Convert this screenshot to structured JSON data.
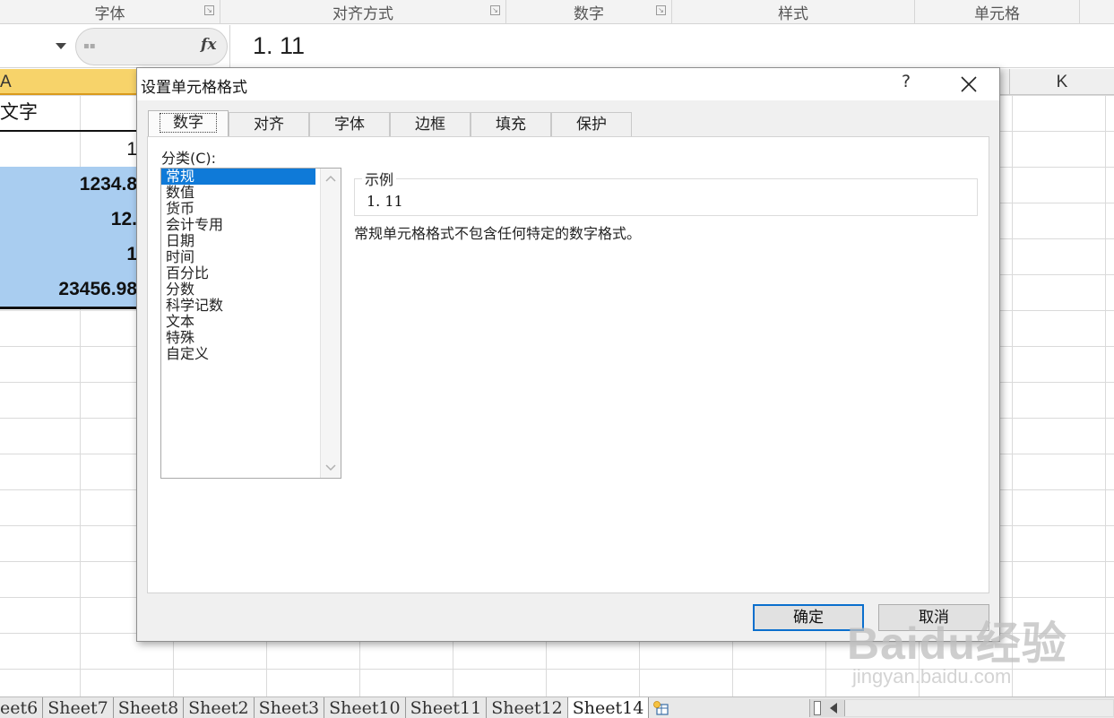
{
  "ribbon": {
    "groups": [
      "字体",
      "对齐方式",
      "数字",
      "样式",
      "单元格"
    ]
  },
  "formula_bar": {
    "fx_label": "fx",
    "value": "1. 11"
  },
  "sheet": {
    "column_a_header": "A",
    "column_k_header": "K",
    "cells": [
      "文字",
      "1",
      "1234.8",
      "12.",
      "1",
      "23456.98"
    ]
  },
  "sheet_tabs": [
    "eet6",
    "Sheet7",
    "Sheet8",
    "Sheet2",
    "Sheet3",
    "Sheet10",
    "Sheet11",
    "Sheet12",
    "Sheet14"
  ],
  "active_sheet": "Sheet14",
  "dialog": {
    "title": "设置单元格格式",
    "help": "?",
    "tabs": [
      "数字",
      "对齐",
      "字体",
      "边框",
      "填充",
      "保护"
    ],
    "active_tab": "数字",
    "category_label": "分类(C):",
    "categories": [
      "常规",
      "数值",
      "货币",
      "会计专用",
      "日期",
      "时间",
      "百分比",
      "分数",
      "科学记数",
      "文本",
      "特殊",
      "自定义"
    ],
    "selected_category": "常规",
    "sample_label": "示例",
    "sample_value": "1. 11",
    "description": "常规单元格格式不包含任何特定的数字格式。",
    "ok": "确定",
    "cancel": "取消"
  },
  "watermark": {
    "logo": "Baidu经验",
    "url": "jingyan.baidu.com"
  },
  "colors": {
    "selection_blue": "#0f7ad8",
    "cell_fill": "#a9cdf0",
    "column_header_active": "#f7d36a"
  }
}
